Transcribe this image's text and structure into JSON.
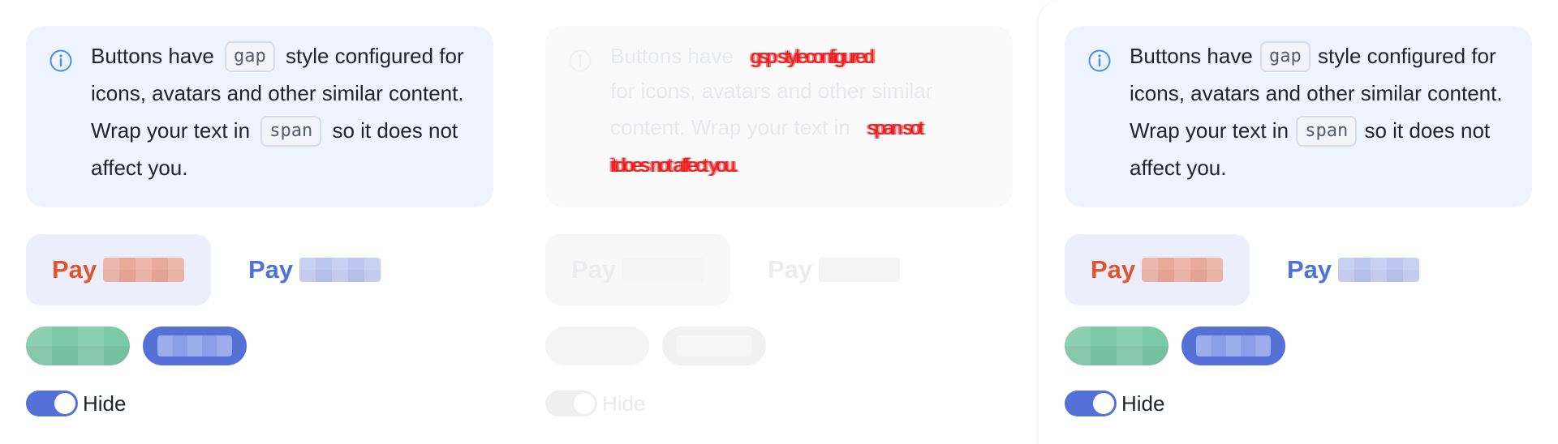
{
  "panels": [
    {
      "id": "left",
      "info": {
        "t1": "Buttons have",
        "code1": "gap",
        "t2": "style configured for icons, avatars and other similar content. Wrap your text in",
        "code2": "span",
        "t3": "so it does not affect you."
      },
      "pay_primary_label": "Pay",
      "pay_plain_label": "Pay",
      "toggle": {
        "label": "Hide",
        "on": true
      }
    },
    {
      "id": "middle",
      "info": {
        "t1": "Buttons have",
        "ghost1": "gsp styleconfigured",
        "l2": "for icons, avatars and other similar",
        "l3": "content. Wrap your text in",
        "ghost2": "span sot",
        "ghost3": "itdoes not affect you."
      },
      "pay_primary_label": "Pay",
      "pay_plain_label": "Pay",
      "toggle": {
        "label": "Hide",
        "on": true
      }
    },
    {
      "id": "right",
      "info": {
        "t1": "Buttons have",
        "code1": "gap",
        "t2": "style configured for icons, avatars and other similar content. Wrap your text in",
        "code2": "span",
        "t3": "so it does not affect you."
      },
      "pay_primary_label": "Pay",
      "pay_plain_label": "Pay",
      "toggle": {
        "label": "Hide",
        "on": true
      }
    }
  ],
  "colors": {
    "info_bg": "#edf4fe",
    "pay_primary_text": "#e0552f",
    "pay_primary_bg": "#eceefc",
    "pay_plain_text": "#4d73d6",
    "pill_green": "#7cc9a8",
    "pill_blue": "#5570d6",
    "toggle_on": "#5570d6"
  },
  "icons": {
    "info": "info-circle-icon"
  }
}
